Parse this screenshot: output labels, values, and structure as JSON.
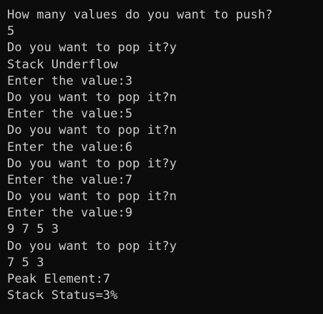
{
  "terminal": {
    "colors": {
      "background": "#0c0c0c",
      "foreground": "#cccccc"
    },
    "lines": [
      "How many values do you want to push?",
      "5",
      "Do you want to pop it?y",
      "Stack Underflow",
      "Enter the value:3",
      "Do you want to pop it?n",
      "Enter the value:5",
      "Do you want to pop it?n",
      "Enter the value:6",
      "Do you want to pop it?y",
      "Enter the value:7",
      "Do you want to pop it?n",
      "Enter the value:9",
      "9 7 5 3",
      "Do you want to pop it?y",
      "7 5 3",
      "Peak Element:7",
      "Stack Status=3%"
    ]
  }
}
